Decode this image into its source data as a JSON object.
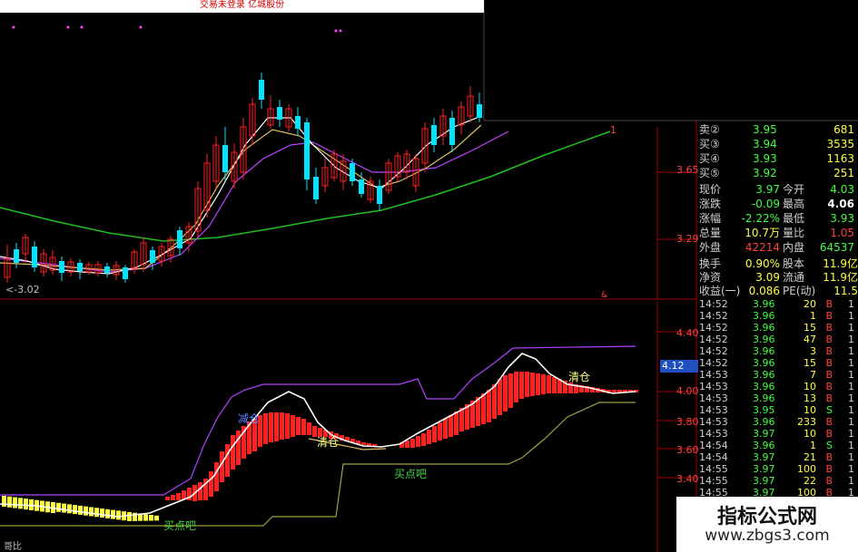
{
  "window": {
    "title": "交易未登录 亿城股份"
  },
  "main_chart": {
    "price_labels": [
      "3.65",
      "3.29"
    ],
    "low_marker": "<-3.02",
    "right_marker": "1"
  },
  "indicator": {
    "price_labels": [
      "4.40",
      "4.12",
      "4.00",
      "3.80",
      "3.60",
      "3.40"
    ],
    "current_price_box": "4.12",
    "labels": {
      "reduce": "减仓",
      "clear_mid": "清仓",
      "clear_right": "清仓",
      "buy_left": "买点吧",
      "buy_right": "买点吧"
    },
    "bottom_left_label": "哥比"
  },
  "quote_panel": {
    "asks": [
      {
        "label": "卖②",
        "price": "3.95",
        "volume": "681"
      },
      {
        "label": "买③",
        "price": "3.94",
        "volume": "3535"
      },
      {
        "label": "买④",
        "price": "3.93",
        "volume": "1163"
      },
      {
        "label": "买⑤",
        "price": "3.92",
        "volume": "251"
      }
    ],
    "stats": [
      {
        "l1": "现价",
        "v1": "3.97",
        "l2": "今开",
        "v2": "4.03"
      },
      {
        "l1": "涨跌",
        "v1": "-0.09",
        "l2": "最高",
        "v2": "4.06"
      },
      {
        "l1": "涨幅",
        "v1": "-2.22%",
        "l2": "最低",
        "v2": "3.93"
      },
      {
        "l1": "总量",
        "v1": "10.7万",
        "l2": "量比",
        "v2": "1.05"
      },
      {
        "l1": "外盘",
        "v1": "42214",
        "l2": "内盘",
        "v2": "64537"
      }
    ],
    "stats2": [
      {
        "l1": "换手",
        "v1": "0.90%",
        "l2": "股本",
        "v2": "11.9亿"
      },
      {
        "l1": "净资",
        "v1": "3.09",
        "l2": "流通",
        "v2": "11.9亿"
      },
      {
        "l1": "收益(一)",
        "v1": "0.086",
        "l2": "PE(动)",
        "v2": "11.5"
      }
    ],
    "ticks": [
      {
        "time": "14:52",
        "price": "3.96",
        "vol": "20",
        "side": "B"
      },
      {
        "time": "14:52",
        "price": "3.96",
        "vol": "1",
        "side": "B"
      },
      {
        "time": "14:52",
        "price": "3.96",
        "vol": "15",
        "side": "B"
      },
      {
        "time": "14:52",
        "price": "3.96",
        "vol": "47",
        "side": "B"
      },
      {
        "time": "14:52",
        "price": "3.96",
        "vol": "3",
        "side": "B"
      },
      {
        "time": "14:52",
        "price": "3.96",
        "vol": "15",
        "side": "B"
      },
      {
        "time": "14:53",
        "price": "3.96",
        "vol": "7",
        "side": "B"
      },
      {
        "time": "14:53",
        "price": "3.96",
        "vol": "10",
        "side": "B"
      },
      {
        "time": "14:53",
        "price": "3.96",
        "vol": "13",
        "side": "B"
      },
      {
        "time": "14:53",
        "price": "3.95",
        "vol": "10",
        "side": "S"
      },
      {
        "time": "14:53",
        "price": "3.96",
        "vol": "233",
        "side": "B"
      },
      {
        "time": "14:53",
        "price": "3.97",
        "vol": "10",
        "side": "B"
      },
      {
        "time": "14:54",
        "price": "3.96",
        "vol": "1",
        "side": "S"
      },
      {
        "time": "14:54",
        "price": "3.97",
        "vol": "21",
        "side": "B"
      },
      {
        "time": "14:55",
        "price": "3.97",
        "vol": "100",
        "side": "B"
      },
      {
        "time": "14:55",
        "price": "3.97",
        "vol": "22",
        "side": "B"
      },
      {
        "time": "14:55",
        "price": "3.97",
        "vol": "100",
        "side": "B"
      }
    ]
  },
  "watermark": {
    "title": "指标公式网",
    "url": "www.zbgs3.com"
  },
  "colors": {
    "up": "#ff2020",
    "down": "#00e5ff",
    "ma5": "#ffffff",
    "ma10": "#e0c060",
    "ma20": "#c040ff",
    "ma60": "#20c020",
    "band_upper": "#b040ff",
    "band_lower": "#a0a040",
    "grid": "#a00000",
    "yellow_bar": "#ffff40"
  }
}
